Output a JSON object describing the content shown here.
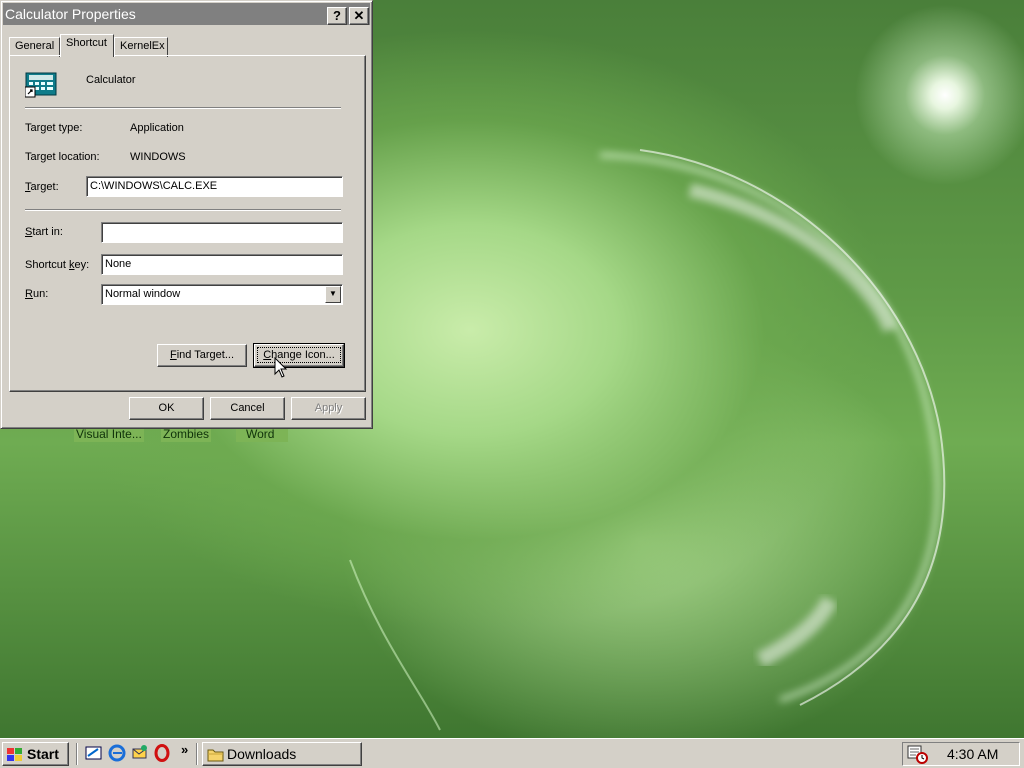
{
  "window": {
    "title": "Calculator Properties",
    "help_glyph": "?",
    "close_glyph": "✕"
  },
  "tabs": [
    {
      "label": "General"
    },
    {
      "label": "Shortcut"
    },
    {
      "label": "KernelEx"
    }
  ],
  "shortcut": {
    "app_name": "Calculator",
    "target_type_label": "Target type:",
    "target_type_value": "Application",
    "target_location_label": "Target location:",
    "target_location_value": "WINDOWS",
    "target_label_prefix": "",
    "target_label_accel": "T",
    "target_label_rest": "arget:",
    "target_value": "C:\\WINDOWS\\CALC.EXE",
    "start_in_label_prefix": "",
    "start_in_label_accel": "S",
    "start_in_label_rest": "tart in:",
    "start_in_value": "",
    "shortcut_key_label_prefix": "Shortcut ",
    "shortcut_key_label_accel": "k",
    "shortcut_key_label_rest": "ey:",
    "shortcut_key_value": "None",
    "run_label_prefix": "",
    "run_label_accel": "R",
    "run_label_rest": "un:",
    "run_value": "Normal window",
    "find_target_prefix": "",
    "find_target_accel": "F",
    "find_target_rest": "ind Target...",
    "change_icon_prefix": "",
    "change_icon_accel": "C",
    "change_icon_rest": "hange Icon..."
  },
  "footer": {
    "ok": "OK",
    "cancel": "Cancel",
    "apply": "Apply"
  },
  "desktop": {
    "labels": [
      "Visual Inte...",
      "Zombies",
      "Word"
    ]
  },
  "taskbar": {
    "start": "Start",
    "chevron": "»",
    "task": "Downloads",
    "clock": "4:30 AM"
  }
}
